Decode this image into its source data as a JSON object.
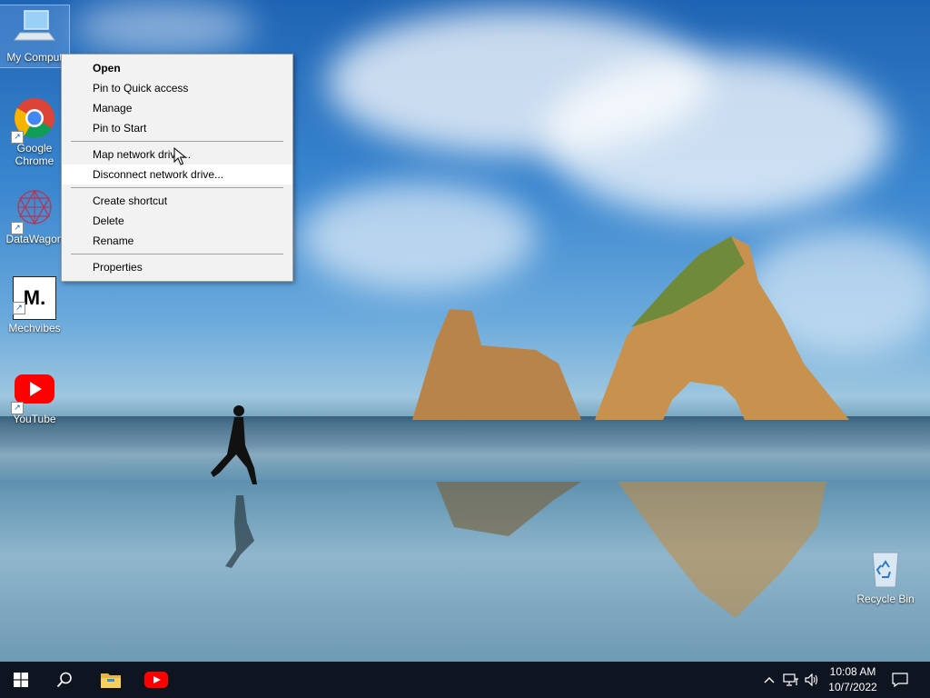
{
  "desktop_icons": [
    {
      "label": "My Comput",
      "icon": "computer-icon"
    },
    {
      "label": "Google Chrome",
      "icon": "chrome-icon"
    },
    {
      "label": "DataWagon",
      "icon": "datawagon-icon"
    },
    {
      "label": "Mechvibes",
      "icon": "mechvibes-icon",
      "glyph": "M."
    },
    {
      "label": "YouTube",
      "icon": "youtube-icon"
    },
    {
      "label": "Recycle Bin",
      "icon": "recycle-bin-icon"
    }
  ],
  "context_menu": {
    "open": "Open",
    "pin_quick": "Pin to Quick access",
    "manage": "Manage",
    "pin_start": "Pin to Start",
    "map_drive": "Map network drive...",
    "disconnect_drive": "Disconnect network drive...",
    "create_shortcut": "Create shortcut",
    "delete": "Delete",
    "rename": "Rename",
    "properties": "Properties"
  },
  "taskbar": {
    "start_icon": "windows-logo-icon",
    "search_icon": "search-icon",
    "pinned": [
      "file-explorer-icon",
      "youtube-icon"
    ],
    "tray_icons": [
      "chevron-up-icon",
      "network-icon",
      "volume-icon",
      "notification-icon"
    ],
    "time": "10:08 AM",
    "date": "10/7/2022"
  },
  "colors": {
    "taskbar": "#0f1520",
    "menu_bg": "#f2f2f2",
    "youtube_red": "#ff0000"
  }
}
